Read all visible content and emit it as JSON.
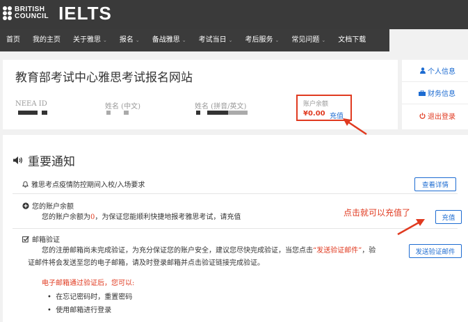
{
  "brand": {
    "british_council_line1": "BRITISH",
    "british_council_line2": "COUNCIL",
    "ielts": "IELTS"
  },
  "nav": {
    "items": [
      {
        "label": "首页",
        "has_dropdown": false
      },
      {
        "label": "我的主页",
        "has_dropdown": false
      },
      {
        "label": "关于雅思",
        "has_dropdown": true
      },
      {
        "label": "报名",
        "has_dropdown": true
      },
      {
        "label": "备战雅思",
        "has_dropdown": true
      },
      {
        "label": "考试当日",
        "has_dropdown": true
      },
      {
        "label": "考后服务",
        "has_dropdown": true
      },
      {
        "label": "常见问题",
        "has_dropdown": true
      },
      {
        "label": "文档下载",
        "has_dropdown": false
      }
    ]
  },
  "header_card": {
    "title": "教育部考试中心雅思考试报名网站",
    "fields": [
      {
        "label": "NEEA ID"
      },
      {
        "label": "姓名 (中文)"
      },
      {
        "label": "姓名 (拼音/英文)"
      }
    ],
    "balance": {
      "label": "账户余额",
      "amount": "¥0.00",
      "recharge_link": "充值"
    }
  },
  "side_menu": {
    "items": [
      {
        "label": "个人信息",
        "icon": "user-icon"
      },
      {
        "label": "财务信息",
        "icon": "briefcase-icon"
      },
      {
        "label": "退出登录",
        "icon": "power-icon"
      }
    ]
  },
  "notices": {
    "title": "重要通知",
    "covid": {
      "text": "雅思考点疫情防控期间入校/入场要求",
      "button": "查看详情"
    },
    "balance": {
      "title": "您的账户余额",
      "text_prefix": "您的账户余额为",
      "text_amount": "0",
      "text_suffix": "，为保证您能顺利快捷地报考雅思考试，请充值",
      "button": "充值"
    },
    "email": {
      "title": "邮箱验证",
      "text_line1_a": "您的注册邮箱尚未完成验证，为充分保证您的账户安全，建议您尽快完成验证，当您点击",
      "text_line1_link": "“发送验证邮件”",
      "text_line1_b": "，验",
      "text_line2": "证邮件将会发送至您的电子邮箱，请及时登录邮箱并点击验证链接完成验证。",
      "button": "发送验证邮件",
      "after_verify_title": "电子邮箱通过验证后，您可以:",
      "bullets": [
        "在忘记密码时，重置密码",
        "使用邮箱进行登录"
      ]
    }
  },
  "annotation": {
    "text": "点击就可以充值了"
  },
  "colors": {
    "header_bg": "#3a3a3a",
    "accent_red": "#e03a20",
    "link_blue": "#1c6bd1",
    "page_bg": "#f1f1f1"
  }
}
